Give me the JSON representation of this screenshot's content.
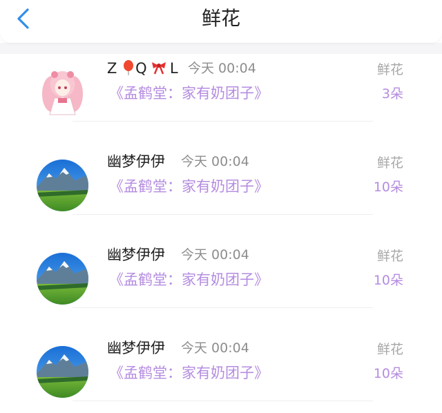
{
  "header": {
    "title": "鲜花",
    "back_icon": "chevron-left-icon",
    "accent_color": "#2f8ee8"
  },
  "colors": {
    "book_text": "#b48ce0",
    "count_text": "#b48ce0",
    "muted_text": "#8d8d8d"
  },
  "records": [
    {
      "user_part1": "Z",
      "user_part2": "Q",
      "user_part3": "L",
      "user_emojis": [
        "balloon-icon",
        "ribbon-icon"
      ],
      "time": "今天 00:04",
      "book": "《孟鹤堂：家有奶团子》",
      "gift": "鲜花",
      "count": "3朵",
      "avatar": "anime-girl-avatar"
    },
    {
      "user": "幽梦伊伊",
      "time": "今天 00:04",
      "book": "《孟鹤堂：家有奶团子》",
      "gift": "鲜花",
      "count": "10朵",
      "avatar": "mountain-landscape-avatar"
    },
    {
      "user": "幽梦伊伊",
      "time": "今天 00:04",
      "book": "《孟鹤堂：家有奶团子》",
      "gift": "鲜花",
      "count": "10朵",
      "avatar": "mountain-landscape-avatar"
    },
    {
      "user": "幽梦伊伊",
      "time": "今天 00:04",
      "book": "《孟鹤堂：家有奶团子》",
      "gift": "鲜花",
      "count": "10朵",
      "avatar": "mountain-landscape-avatar"
    }
  ]
}
